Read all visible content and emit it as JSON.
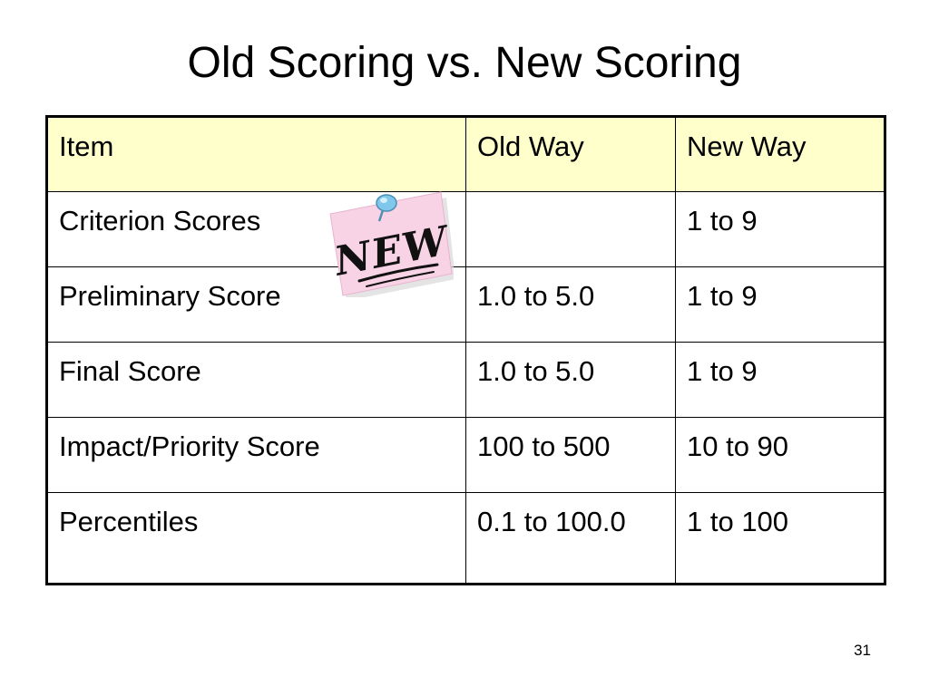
{
  "slide": {
    "title": "Old Scoring vs. New Scoring",
    "page_number": "31"
  },
  "table": {
    "headers": [
      "Item",
      "Old Way",
      "New Way"
    ],
    "rows": [
      [
        "Criterion Scores",
        "",
        "1 to 9"
      ],
      [
        "Preliminary Score",
        "1.0 to 5.0",
        "1 to 9"
      ],
      [
        "Final Score",
        "1.0 to 5.0",
        "1 to 9"
      ],
      [
        "Impact/Priority Score",
        "100 to 500",
        "10 to 90"
      ],
      [
        "Percentiles",
        "0.1 to 100.0",
        "1 to 100"
      ]
    ]
  },
  "sticky_note": {
    "text": "NEW",
    "paper_color": "#f8d3e6",
    "pin_color": "#7fc8ec",
    "icon": "pushpin-icon"
  },
  "colors": {
    "header_fill": "#ffffcc",
    "border": "#000000",
    "background": "#ffffff"
  }
}
